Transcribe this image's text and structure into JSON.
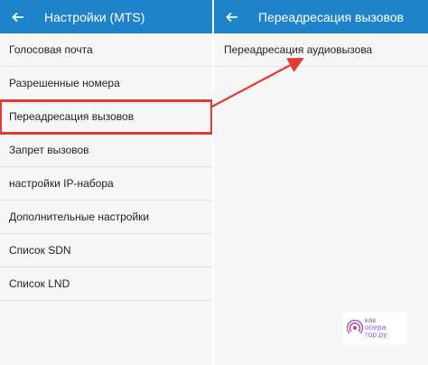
{
  "left_screen": {
    "title": "Настройки (MTS)",
    "items": [
      {
        "label": "Голосовая почта"
      },
      {
        "label": "Разрешенные номера"
      },
      {
        "label": "Переадресация вызовов"
      },
      {
        "label": "Запрет вызовов"
      },
      {
        "label": "настройки IP-набора"
      },
      {
        "label": "Дополнительные настройки"
      },
      {
        "label": "Список SDN"
      },
      {
        "label": "Список LND"
      }
    ]
  },
  "right_screen": {
    "title": "Переадресация вызовов",
    "items": [
      {
        "label": "Переадресация аудиовызова"
      }
    ]
  },
  "watermark": {
    "line1": "как",
    "line2": "опера",
    "line3": "тор.ру"
  },
  "colors": {
    "appbar": "#1f83c9",
    "highlight": "#e53935",
    "watermark": "#8a5cc8"
  }
}
